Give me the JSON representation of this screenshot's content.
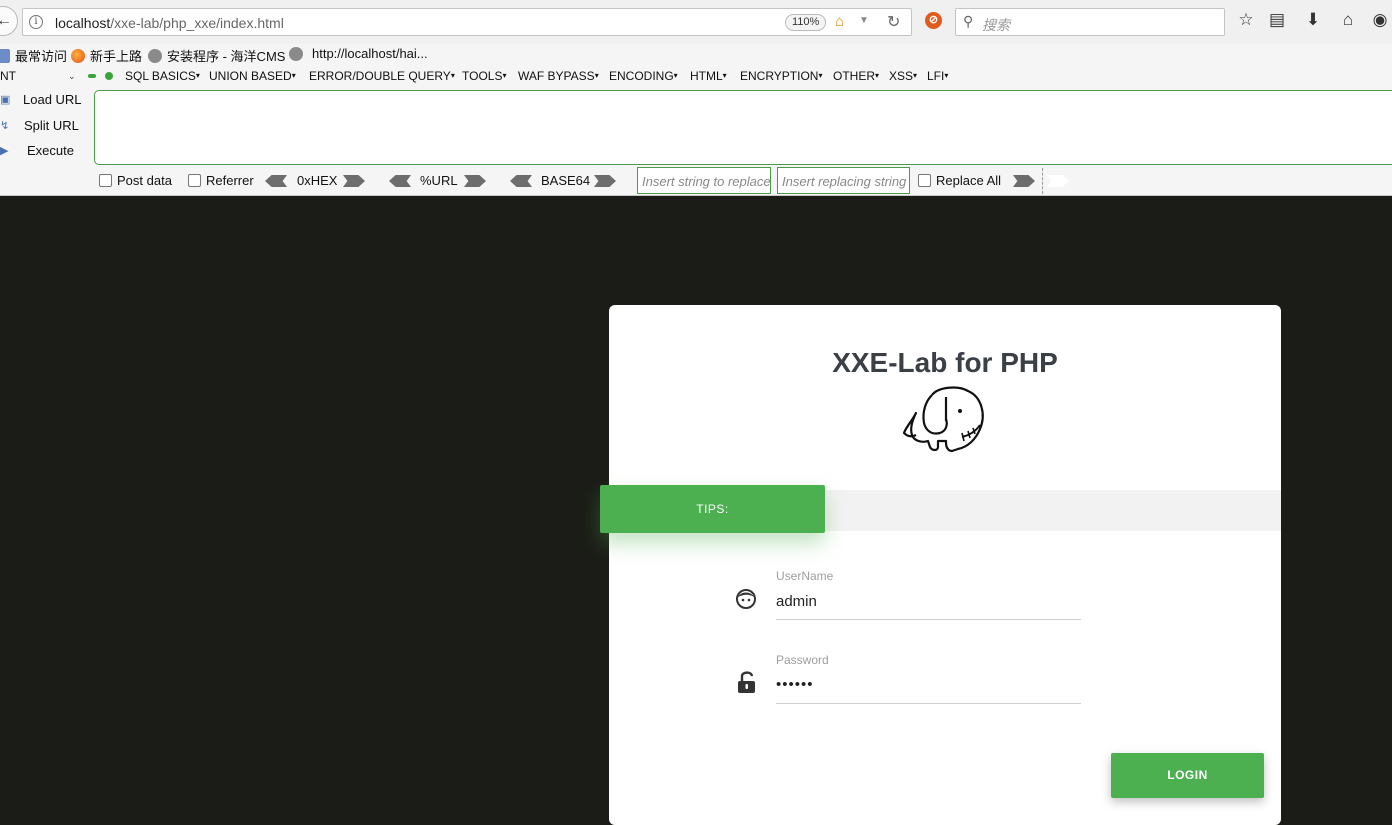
{
  "browser": {
    "url_host": "localhost",
    "url_path": "/xxe-lab/php_xxe/index.html",
    "zoom": "110%",
    "search_placeholder": "搜索"
  },
  "bookmarks": [
    {
      "label": "最常访问"
    },
    {
      "label": "新手上路"
    },
    {
      "label": "安装程序 - 海洋CMS"
    },
    {
      "label": "http://localhost/hai..."
    }
  ],
  "hackbar": {
    "dropdown_value": "NT",
    "menus": [
      "SQL BASICS",
      "UNION BASED",
      "ERROR/DOUBLE QUERY",
      "TOOLS",
      "WAF BYPASS",
      "ENCODING",
      "HTML",
      "ENCRYPTION",
      "OTHER",
      "XSS",
      "LFI"
    ],
    "load_url": "Load URL",
    "split_url": "Split URL",
    "execute": "Execute",
    "post_data": "Post data",
    "referrer": "Referrer",
    "hex": "0xHEX",
    "urlenc": "%URL",
    "base64": "BASE64",
    "replace_ph": "Insert string to replace",
    "replacing_ph": "Insert replacing string",
    "replace_all": "Replace All"
  },
  "page": {
    "title": "XXE-Lab for PHP",
    "tips": "TIPS:",
    "username_label": "UserName",
    "username_value": "admin",
    "password_label": "Password",
    "password_value": "••••••",
    "login": "LOGIN"
  },
  "colors": {
    "accent_green": "#4caf50",
    "page_bg": "#1b1c17"
  }
}
